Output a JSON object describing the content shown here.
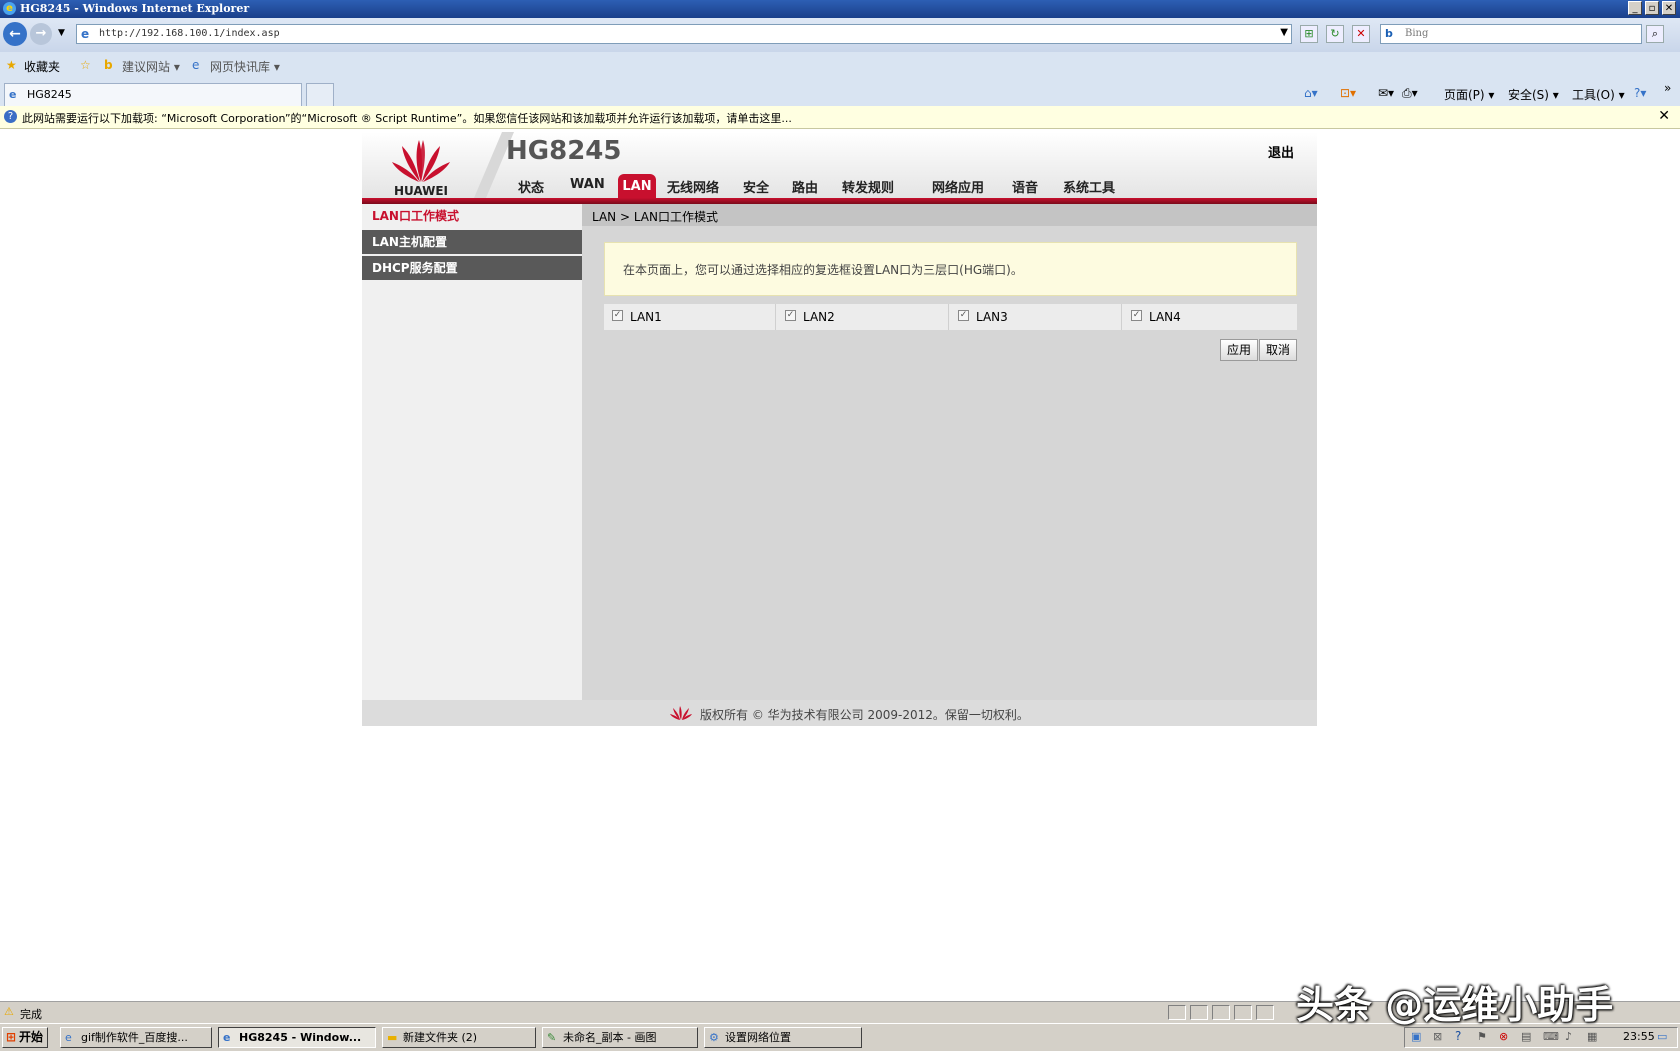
{
  "window": {
    "title": "HG8245 - Windows Internet Explorer"
  },
  "browser": {
    "url": "http://192.168.100.1/index.asp",
    "search_placeholder": "Bing",
    "favorites_label": "收藏夹",
    "fav_items": [
      "建议网站 ▾",
      "网页快讯库 ▾"
    ],
    "tab_title": "HG8245",
    "commands": [
      "页面(P) ▾",
      "安全(S) ▾",
      "工具(O) ▾"
    ]
  },
  "infobar": {
    "text": "此网站需要运行以下加载项: “Microsoft Corporation”的“Microsoft ® Script Runtime”。如果您信任该网站和该加载项并允许运行该加载项，请单击这里..."
  },
  "router": {
    "brand": "HUAWEI",
    "model": "HG8245",
    "logout": "退出",
    "nav": [
      "状态",
      "WAN",
      "LAN",
      "无线网络",
      "安全",
      "路由",
      "转发规则",
      "网络应用",
      "语音",
      "系统工具"
    ],
    "sidebar": [
      "LAN口工作模式",
      "LAN主机配置",
      "DHCP服务配置"
    ],
    "breadcrumb": "LAN > LAN口工作模式",
    "tip": "在本页面上，您可以通过选择相应的复选框设置LAN口为三层口(HG端口)。",
    "ports": [
      {
        "label": "LAN1",
        "checked": true
      },
      {
        "label": "LAN2",
        "checked": true
      },
      {
        "label": "LAN3",
        "checked": true
      },
      {
        "label": "LAN4",
        "checked": true
      }
    ],
    "apply": "应用",
    "cancel": "取消",
    "footer": "版权所有 © 华为技术有限公司 2009-2012。保留一切权利。"
  },
  "statusbar": {
    "text": "完成"
  },
  "taskbar": {
    "start": "开始",
    "tasks": [
      "gif制作软件_百度搜...",
      "HG8245 - Window...",
      "新建文件夹  (2)",
      "未命名_副本 - 画图",
      "设置网络位置"
    ],
    "clock": "23:55"
  },
  "watermark": "头条 @运维小助手",
  "colors": {
    "accent": "#c8102e",
    "sidebar_dark": "#595959",
    "tip_bg": "#fdfbe0"
  }
}
